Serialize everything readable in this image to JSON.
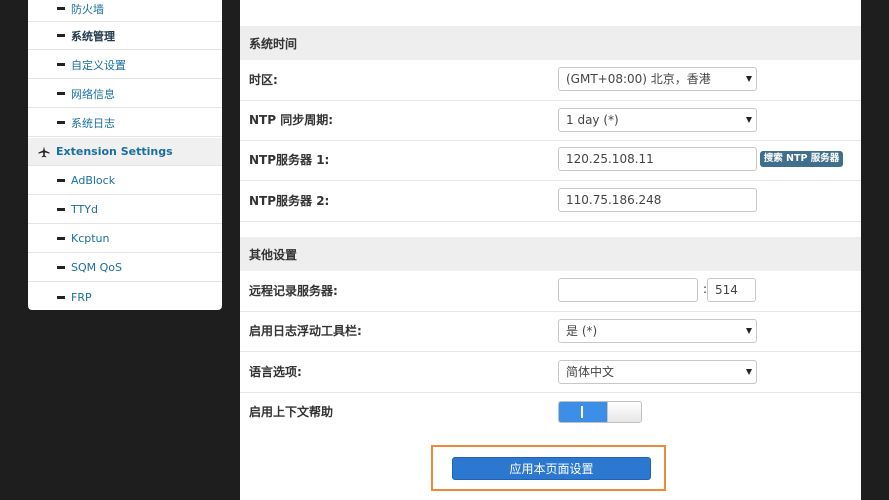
{
  "sidebar": {
    "items": [
      {
        "label": "防火墙",
        "kind": "sub"
      },
      {
        "label": "系统管理",
        "kind": "sub",
        "active": true
      },
      {
        "label": "自定义设置",
        "kind": "sub"
      },
      {
        "label": "网络信息",
        "kind": "sub"
      },
      {
        "label": "系统日志",
        "kind": "sub"
      },
      {
        "label": "Extension Settings",
        "kind": "category",
        "icon": "airplane-icon"
      },
      {
        "label": "AdBlock",
        "kind": "sub"
      },
      {
        "label": "TTYd",
        "kind": "sub"
      },
      {
        "label": "Kcptun",
        "kind": "sub"
      },
      {
        "label": "SQM QoS",
        "kind": "sub"
      },
      {
        "label": "FRP",
        "kind": "sub"
      }
    ]
  },
  "system_time": {
    "heading": "系统时间",
    "timezone_label": "时区:",
    "timezone_value": "(GMT+08:00) 北京，香港",
    "ntp_period_label": "NTP 同步周期:",
    "ntp_period_value": "1 day (*)",
    "ntp_server1_label": "NTP服务器 1:",
    "ntp_server1_value": "120.25.108.11",
    "search_ntp_button": "搜索 NTP 服务器",
    "ntp_server2_label": "NTP服务器 2:",
    "ntp_server2_value": "110.75.186.248"
  },
  "other_settings": {
    "heading": "其他设置",
    "remote_log_label": "远程记录服务器:",
    "remote_log_host": "",
    "remote_log_port": "514",
    "log_toolbar_label": "启用日志浮动工具栏:",
    "log_toolbar_value": "是 (*)",
    "language_label": "语言选项:",
    "language_value": "简体中文",
    "context_help_label": "启用上下文帮助",
    "context_help_on": true,
    "toggle_on_glyph": "I"
  },
  "actions": {
    "apply_label": "应用本页面设置"
  },
  "colors": {
    "accent": "#2c78d0",
    "highlight_border": "#ee8a3a",
    "link": "#1a6fa0"
  }
}
